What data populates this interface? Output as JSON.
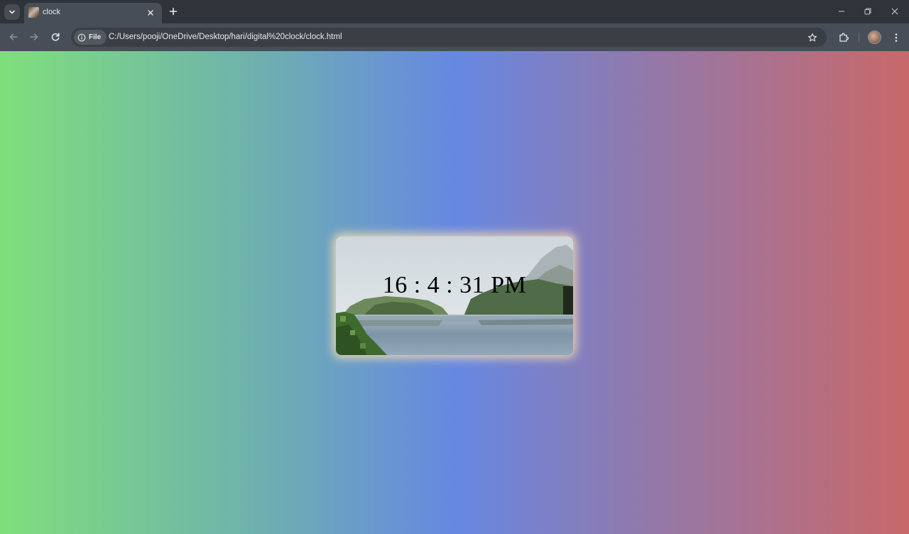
{
  "browser": {
    "tab": {
      "title": "clock",
      "favicon": "page-favicon"
    },
    "address_bar": {
      "site_chip_label": "File",
      "url": "C:/Users/pooji/OneDrive/Desktop/hari/digital%20clock/clock.html"
    },
    "icons": {
      "tab_search": "chevron-down-icon",
      "tab_close": "close-icon",
      "new_tab": "plus-icon",
      "minimize": "minimize-icon",
      "restore": "restore-icon",
      "close_window": "close-icon",
      "back": "arrow-left-icon",
      "forward": "arrow-right-icon",
      "reload": "reload-icon",
      "info": "info-icon",
      "bookmark": "star-icon",
      "extensions": "puzzle-icon",
      "profile": "avatar",
      "menu": "kebab-menu-icon"
    }
  },
  "page": {
    "clock_display": "16 : 4 : 31 PM",
    "background_gradient": [
      "#7fdf7c",
      "#6fb3ac",
      "#6688e2",
      "#9478a8",
      "#c9686a"
    ],
    "card_glow": "#ffe2aa"
  }
}
